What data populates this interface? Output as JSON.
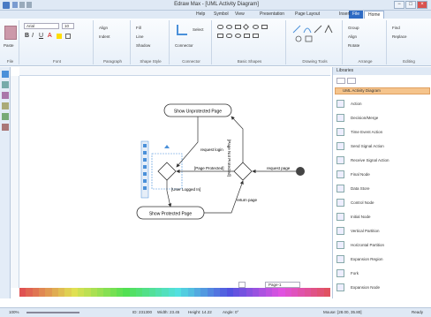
{
  "window": {
    "title": "Edraw Max - [UML Activity Diagram]",
    "buttons": [
      "−",
      "□",
      "×"
    ]
  },
  "tabs": [
    "File",
    "Home",
    "Insert",
    "Page Layout",
    "Presentation",
    "View",
    "Symbol",
    "Help"
  ],
  "active_tab": "Home",
  "ribbon": {
    "groups": [
      {
        "label": "File",
        "items": [
          "Paste",
          "Cut",
          "Copy"
        ]
      },
      {
        "label": "Font",
        "items": [
          "Arial",
          "10",
          "B",
          "I",
          "U",
          "A"
        ]
      },
      {
        "label": "Paragraph",
        "items": [
          "Align",
          "Indent"
        ]
      },
      {
        "label": "Shape Style",
        "items": [
          "Fill",
          "Line",
          "Shadow"
        ]
      },
      {
        "label": "Connector",
        "items": [
          "Connector",
          "Select"
        ]
      },
      {
        "label": "Basic Shapes",
        "items": []
      },
      {
        "label": "Drawing Tools",
        "items": []
      },
      {
        "label": "Arrange",
        "items": [
          "Group",
          "Align",
          "Rotate"
        ]
      },
      {
        "label": "Editing",
        "items": [
          "Find",
          "Replace"
        ]
      }
    ]
  },
  "library": {
    "title": "Libraries",
    "category": "UML Activity Diagram",
    "items": [
      "Action",
      "Decision/Merge",
      "Time Event Action",
      "Send Signal Action",
      "Receive Signal Action",
      "Final Node",
      "Data Store",
      "Control Node",
      "Initial Node",
      "Vertical Partition",
      "Horizontal Partition",
      "Expansion Region",
      "Fork",
      "Expansion Node"
    ]
  },
  "diagram": {
    "top_node": "Show Unprotected Page",
    "bottom_node": "Show Protected Page",
    "labels": {
      "request_page": "request page",
      "page_not_protected": "[Page Not Protected]",
      "page_protected": "[Page Protected]",
      "request_login": "request login",
      "user_logged_in": "[User Logged In]",
      "return_page": "return page",
      "user_logged_on": "[User Logged On]"
    }
  },
  "page_tab": "Page-1",
  "status": {
    "zoom": "100%",
    "width": "Width: 23.45",
    "height": "Height: 14.22",
    "angle": "Angle: 0°",
    "mouse": "Mouse: [28.00, 35.80]",
    "ready": "Ready",
    "id": "ID: 231300"
  },
  "colors": {
    "accent": "#f5c48c",
    "ribbon_bg": "#e8f0f9",
    "selection": "#4a90d9"
  }
}
